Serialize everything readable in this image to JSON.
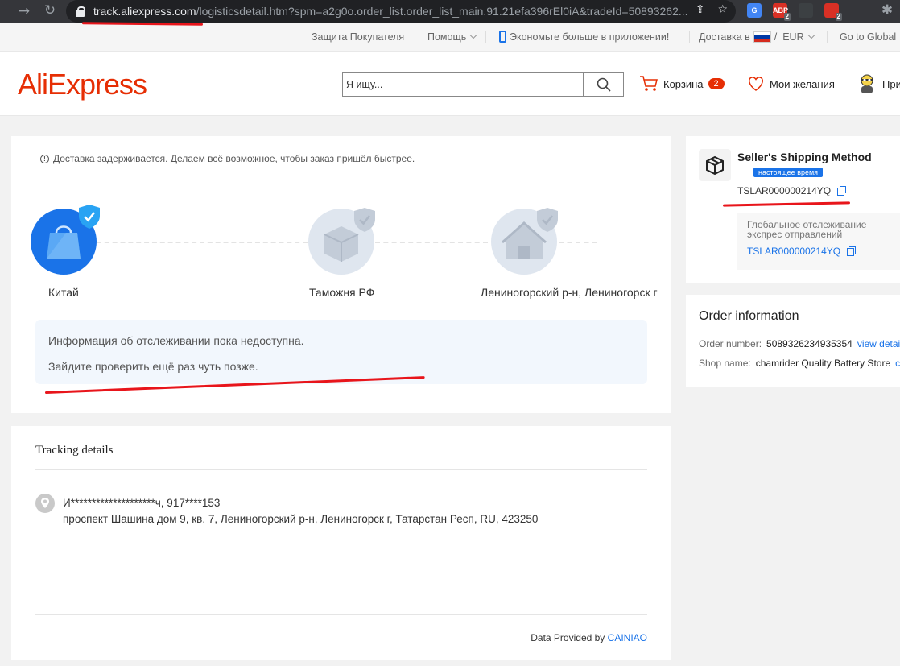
{
  "browser": {
    "url_host": "track.aliexpress.com",
    "url_path": "/logisticsdetail.htm?spm=a2g0o.order_list.order_list_main.91.21efa396rEl0iA&tradeId=50893262...",
    "extensions": [
      {
        "color": "#4285f4",
        "label": "G",
        "count": ""
      },
      {
        "color": "#d93025",
        "label": "ABP",
        "count": "2"
      },
      {
        "color": "#3c4043",
        "label": "",
        "count": ""
      },
      {
        "color": "#d93025",
        "label": "",
        "count": "2"
      }
    ]
  },
  "topnav": {
    "buyer_protection": "Защита Покупателя",
    "help": "Помощь",
    "app_promo": "Экономьте больше в приложении!",
    "delivery_to": "Доставка в",
    "currency": "EUR",
    "go_global": "Go to Global"
  },
  "header": {
    "logo": "AliExpress",
    "search_placeholder": "Я ищу...",
    "cart_label": "Корзина",
    "cart_count": "2",
    "wishlist_label": "Мои желания",
    "account_label": "При"
  },
  "tracking_status": {
    "delay_notice": "Доставка задерживается. Делаем всё возможное, чтобы заказ пришёл быстрее.",
    "steps": [
      {
        "label": "Китай"
      },
      {
        "label": "Таможня РФ"
      },
      {
        "label": "Лениногорский р-н, Лениногорск г"
      }
    ],
    "info_line1": "Информация об отслеживании пока недоступна.",
    "info_line2": "Зайдите проверить ещё раз чуть позже."
  },
  "tracking_details": {
    "title": "Tracking details",
    "recipient": "И********************ч,  917****153",
    "address": "проспект Шашина дом 9, кв. 7,  Лениногорский р-н, Лениногорск г,  Татарстан Респ,  RU,  423250",
    "provided_by": "Data Provided by",
    "provider": "CAINIAO"
  },
  "shipping": {
    "title": "Seller's Shipping Method",
    "realtime_badge": "настоящее время",
    "tracking_number": "TSLAR000000214YQ",
    "global_tracking_label": "Глобальное отслеживание экспрес отправлений",
    "global_tracking_number": "TSLAR000000214YQ"
  },
  "order_info": {
    "title": "Order information",
    "order_number_label": "Order number:",
    "order_number": "5089326234935354",
    "view_details": "view detai",
    "shop_name_label": "Shop name:",
    "shop_name": "chamrider Quality Battery Store",
    "contact": "c"
  },
  "colors": {
    "brand": "#e62e04",
    "link": "#1a73e8",
    "active_step": "#1a73e8",
    "inactive_step": "#dfe6ef",
    "annotation": "#e8151b"
  }
}
